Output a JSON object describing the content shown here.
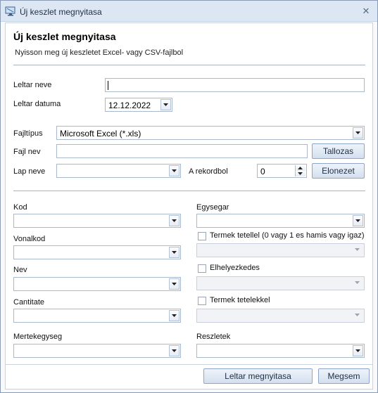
{
  "window": {
    "title": "Új keszlet megnyitasa",
    "close_glyph": "✕"
  },
  "header": {
    "title": "Új keszlet megnyitasa",
    "subtitle": "Nyisson meg új keszletet Excel- vagy CSV-fajlbol"
  },
  "inventory": {
    "name_label": "Leltar neve",
    "name_value": "",
    "date_label": "Leltar datuma",
    "date_value": "12.12.2022"
  },
  "file": {
    "type_label": "Fajltípus",
    "type_value": "Microsoft Excel (*.xls)",
    "name_label": "Fajl nev",
    "name_value": "",
    "browse_label": "Tallozas",
    "sheet_label": "Lap neve",
    "sheet_value": "",
    "from_record_label": "A rekordbol",
    "from_record_value": "0",
    "preview_label": "Elonezet"
  },
  "mapping": {
    "kod_label": "Kod",
    "vonalkod_label": "Vonalkod",
    "nev_label": "Nev",
    "cantitate_label": "Cantitate",
    "mertekegyseg_label": "Mertekegyseg",
    "egysegar_label": "Egysegar",
    "termek_tetellel_label": "Termek tetellel (0 vagy 1 es hamis vagy igaz)",
    "elhelyezkedes_label": "Elhelyezkedes",
    "termek_tetelekkel_label": "Termek tetelekkel",
    "reszletek_label": "Reszletek"
  },
  "footer": {
    "open_label": "Leltar megnyitasa",
    "cancel_label": "Megsem"
  },
  "icons": {
    "app": "monitor-icon",
    "close": "close-icon",
    "dropdown": "chevron-down-icon"
  }
}
